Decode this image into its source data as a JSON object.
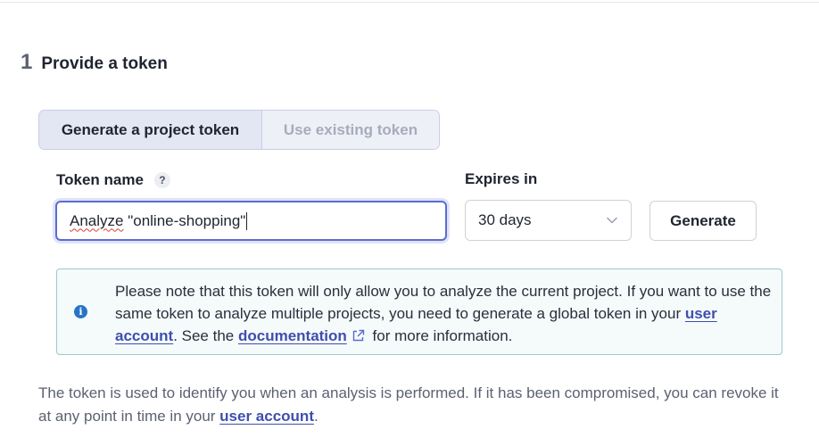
{
  "step": {
    "number": "1",
    "title": "Provide a token"
  },
  "token_mode": {
    "options": [
      "Generate a project token",
      "Use existing token"
    ],
    "selected": "Generate a project token"
  },
  "token_name": {
    "label": "Token name",
    "help": "?",
    "value_misspelled": "Analyze",
    "value_rest": " \"online-shopping\""
  },
  "expires": {
    "label": "Expires in",
    "selected": "30 days"
  },
  "generate_label": "Generate",
  "info": {
    "part1": "Please note that this token will only allow you to analyze the current project. If you want to use the same token to analyze multiple projects, you need to generate a global token in your ",
    "user_account_link": "user account",
    "part2": ". See the ",
    "documentation_link": "documentation",
    "part3": " for more information."
  },
  "footer": {
    "text": "The token is used to identify you when an analysis is performed. If it has been compromised, you can revoke it at any point in time in your ",
    "link": "user account",
    "end": "."
  },
  "colors": {
    "accent": "#5a6cd1",
    "link": "#3d4fae",
    "info_border": "#9cc8cf",
    "info_icon": "#2a73c4"
  }
}
